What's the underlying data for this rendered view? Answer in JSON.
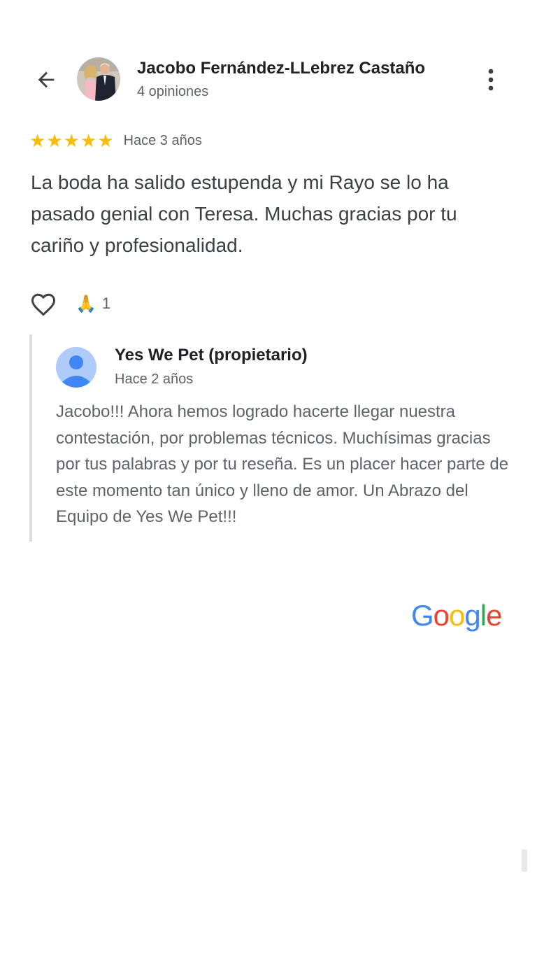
{
  "header": {
    "reviewer_name": "Jacobo Fernández-LLebrez Castaño",
    "reviewer_meta": "4 opiniones",
    "back_icon": "arrow-back-icon",
    "more_icon": "more-vert-icon"
  },
  "review": {
    "rating": 5,
    "rating_max": 5,
    "date": "Hace 3 años",
    "text": "La boda ha salido estupenda y mi Rayo se lo ha pasado genial con Teresa. Muchas gracias por tu cariño y profesionalidad.",
    "reaction_emoji": "🙏",
    "reaction_count": "1"
  },
  "reply": {
    "owner_name": "Yes We Pet (propietario)",
    "date": "Hace 2 años",
    "text": "Jacobo!!! Ahora hemos logrado hacerte llegar nuestra contestación, por problemas técnicos. Muchísimas gracias por tus palabras y por tu reseña. Es un placer hacer parte de este momento tan único y lleno de amor. Un Abrazo del Equipo de Yes We Pet!!!"
  },
  "branding": {
    "logo": [
      "G",
      "o",
      "o",
      "g",
      "l",
      "e"
    ],
    "logo_colors": [
      "#4285F4",
      "#EA4335",
      "#FBBC05",
      "#4285F4",
      "#34A853",
      "#EA4335"
    ]
  },
  "colors": {
    "star": "#fbbc04",
    "text_primary": "#202124",
    "text_secondary": "#5f6368"
  }
}
